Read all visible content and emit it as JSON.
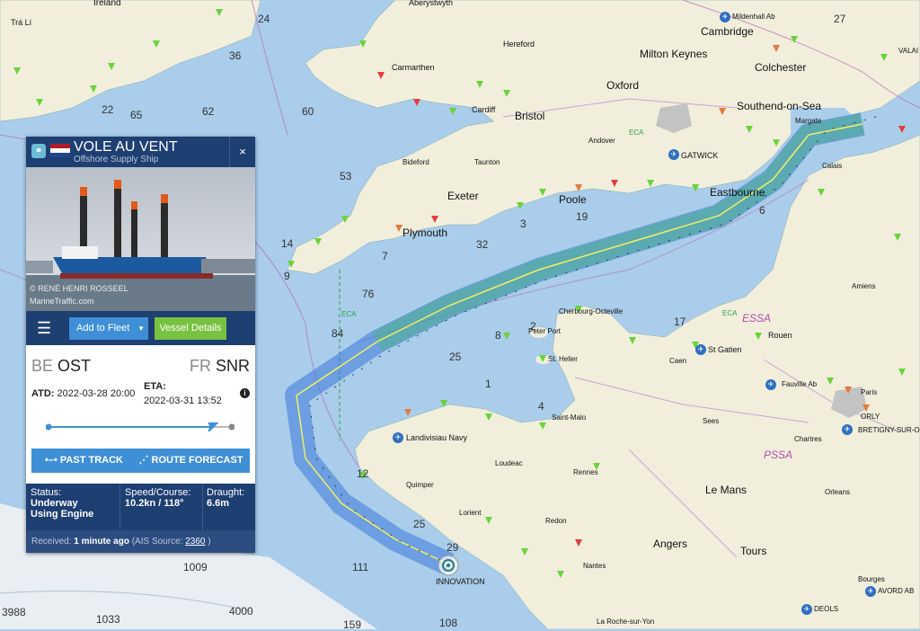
{
  "vessel": {
    "name": "VOLE AU VENT",
    "type": "Offshore Supply Ship",
    "photo_credit": "© RENÉ HENRI ROSSEEL",
    "photo_source": "MarineTraffic.com",
    "add_to_fleet": "Add to Fleet",
    "vessel_details": "Vessel Details",
    "departure_country": "BE",
    "departure_port": "OST",
    "arrival_country": "FR",
    "arrival_port": "SNR",
    "atd_label": "ATD:",
    "atd": "2022-03-28 20:00",
    "eta_label": "ETA:",
    "eta": "2022-03-31 13:52",
    "progress": 0.88,
    "past_track": "PAST TRACK",
    "route_forecast": "ROUTE FORECAST",
    "status_label": "Status:",
    "status_line1": "Underway",
    "status_line2": "Using Engine",
    "speed_label": "Speed/Course:",
    "speed": "10.2kn / 118°",
    "draught_label": "Draught:",
    "draught": "6.6m",
    "received_label": "Received:",
    "received_value": "1 minute ago",
    "ais_prefix": "(AIS Source:",
    "ais_source": "2360",
    "ais_suffix": ")",
    "close": "×"
  },
  "colors": {
    "header": "#1e3f72",
    "button": "#3f8fd6",
    "green": "#79c142",
    "sea": "#a9cdea",
    "land": "#f1efdc"
  },
  "places": {
    "bristol": "Bristol",
    "oxford": "Oxford",
    "cambridge": "Cambridge",
    "milton_keynes": "Milton Keynes",
    "colchester": "Colchester",
    "southend": "Southend-on-Sea",
    "margate": "Margate",
    "hereford": "Hereford",
    "carmarthen": "Carmarthen",
    "aberystwyth": "Aberystwyth",
    "cardiff": "Cardiff",
    "taunton": "Taunton",
    "exeter": "Exeter",
    "plymouth": "Plymouth",
    "bideford": "Bideford",
    "andover": "Andover",
    "eastbourne": "Eastbourne",
    "poole": "Poole",
    "gatwick": "GATWICK",
    "cherbourg": "Cherbourg-Octeville",
    "peter_port": "Peter Port",
    "st_helier": "St. Helier",
    "saint_malo": "Saint-Malo",
    "caen": "Caen",
    "st_gatien": "St Gatien",
    "rouen": "Rouen",
    "amiens": "Amiens",
    "calais": "Calais",
    "paris": "Paris",
    "orly": "ORLY",
    "bretigny": "BRETIGNY-SUR-ORGE",
    "chartres": "Chartres",
    "sees": "Sees",
    "le_mans": "Le Mans",
    "orleans": "Orleans",
    "tours": "Tours",
    "angers": "Angers",
    "nantes": "Nantes",
    "rennes": "Rennes",
    "loudeac": "Loudeac",
    "quimper": "Quimper",
    "lorient": "Lorient",
    "redon": "Redon",
    "landivisiau": "Landivisiau Navy",
    "innovation": "INNOVATION",
    "la_roche": "La Roche-sur-Yon",
    "bourges": "Bourges",
    "avord": "AVORD AB",
    "deols": "DEOLS",
    "ireland": "Ireland",
    "tra_li": "Trá Lí",
    "mildenhall": "Mildenhall Ab",
    "valais": "VALAI",
    "fauville": "Fauville Ab",
    "eca": "ECA",
    "essa": "ESSA",
    "pssa": "PSSA"
  },
  "depths": [
    "24",
    "36",
    "62",
    "60",
    "22",
    "65",
    "53",
    "84",
    "76",
    "25",
    "111",
    "1009",
    "1033",
    "3988",
    "4000",
    "108",
    "159",
    "27",
    "14",
    "9",
    "32",
    "7",
    "19",
    "3",
    "1",
    "4",
    "2",
    "12",
    "25",
    "29",
    "17",
    "8",
    "6"
  ]
}
